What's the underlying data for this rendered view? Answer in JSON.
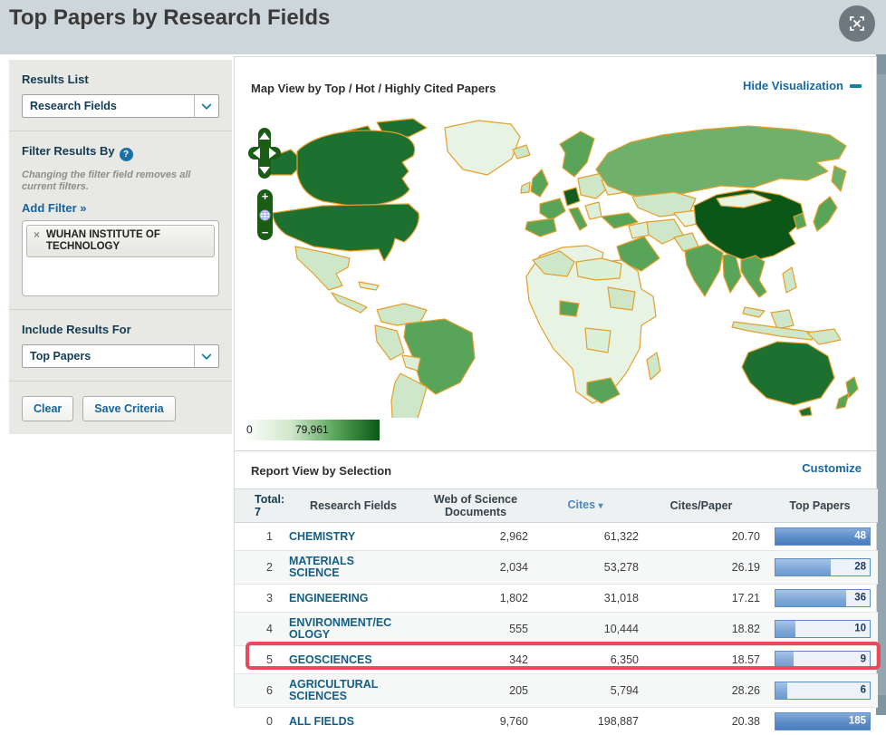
{
  "page": {
    "title": "Top Papers by Research Fields"
  },
  "icons": {
    "expand": "expand-icon",
    "help": "?",
    "remove": "×",
    "chevron_down": "chevron-down-icon",
    "minus": "−",
    "sort_down": "▾",
    "zoom_in": "+",
    "zoom_out": "−",
    "globe": "globe-icon"
  },
  "sidebar": {
    "results_list_label": "Results List",
    "results_list_value": "Research Fields",
    "filter_label": "Filter Results By",
    "filter_help": "?",
    "filter_note": "Changing the filter field removes all current filters.",
    "add_filter_label": "Add Filter »",
    "filter_chip": {
      "remove_icon": "×",
      "label": "WUHAN INSTITUTE OF TECHNOLOGY"
    },
    "include_label": "Include Results For",
    "include_value": "Top Papers",
    "clear_button": "Clear",
    "save_button": "Save Criteria"
  },
  "map": {
    "title": "Map View by Top / Hot / Highly Cited Papers",
    "hide_link": "Hide Visualization",
    "legend_min": "0",
    "legend_max": "79,961",
    "zoom_in": "+",
    "zoom_out": "−"
  },
  "report": {
    "title": "Report View by Selection",
    "customize_link": "Customize"
  },
  "table": {
    "total_label": "Total:",
    "total_value": "7",
    "headers": {
      "field": "Research Fields",
      "docs": "Web of Science Documents",
      "cites": "Cites",
      "cites_sort": "▾",
      "cpp": "Cites/Paper",
      "top": "Top Papers"
    },
    "bar_max": 48,
    "rows": [
      {
        "rank": "1",
        "field": "CHEMISTRY",
        "docs": "2,962",
        "cites": "61,322",
        "cpp": "20.70",
        "top_papers": 48,
        "highlight": false
      },
      {
        "rank": "2",
        "field": "MATERIALS SCIENCE",
        "docs": "2,034",
        "cites": "53,278",
        "cpp": "26.19",
        "top_papers": 28,
        "highlight": false
      },
      {
        "rank": "3",
        "field": "ENGINEERING",
        "docs": "1,802",
        "cites": "31,018",
        "cpp": "17.21",
        "top_papers": 36,
        "highlight": false
      },
      {
        "rank": "4",
        "field": "ENVIRONMENT/ECOLOGY",
        "docs": "555",
        "cites": "10,444",
        "cpp": "18.82",
        "top_papers": 10,
        "highlight": false
      },
      {
        "rank": "5",
        "field": "GEOSCIENCES",
        "docs": "342",
        "cites": "6,350",
        "cpp": "18.57",
        "top_papers": 9,
        "highlight": true
      },
      {
        "rank": "6",
        "field": "AGRICULTURAL SCIENCES",
        "docs": "205",
        "cites": "5,794",
        "cpp": "28.26",
        "top_papers": 6,
        "highlight": false
      },
      {
        "rank": "0",
        "field": "ALL FIELDS",
        "docs": "9,760",
        "cites": "198,887",
        "cpp": "20.38",
        "top_papers": 185,
        "highlight": false
      }
    ]
  },
  "chart_data": [
    {
      "type": "bar",
      "title": "Top Papers per Research Field",
      "orientation": "horizontal",
      "categories": [
        "CHEMISTRY",
        "MATERIALS SCIENCE",
        "ENGINEERING",
        "ENVIRONMENT/ECOLOGY",
        "GEOSCIENCES",
        "AGRICULTURAL SCIENCES",
        "ALL FIELDS"
      ],
      "values": [
        48,
        28,
        36,
        10,
        9,
        6,
        185
      ],
      "bar_scale_max": 48
    },
    {
      "type": "heatmap",
      "subtype": "world-choropleth",
      "title": "Map View by Top / Hot / Highly Cited Papers",
      "color_scale": [
        "#ffffff",
        "#0a5718"
      ],
      "value_range": [
        0,
        79961
      ],
      "legend_labels": [
        "0",
        "79,961"
      ]
    }
  ],
  "colors": {
    "header_band": "#cdd6da",
    "link_blue": "#1668a2",
    "field_link": "#135f85",
    "cites_header": "#4d86c0",
    "highlight_red": "#e8495c",
    "map_border_orange": "#e59f2c",
    "map_dark_green": "#1d7030",
    "map_darkest_green": "#0a5718",
    "bar_border": "#5d8dc9"
  }
}
